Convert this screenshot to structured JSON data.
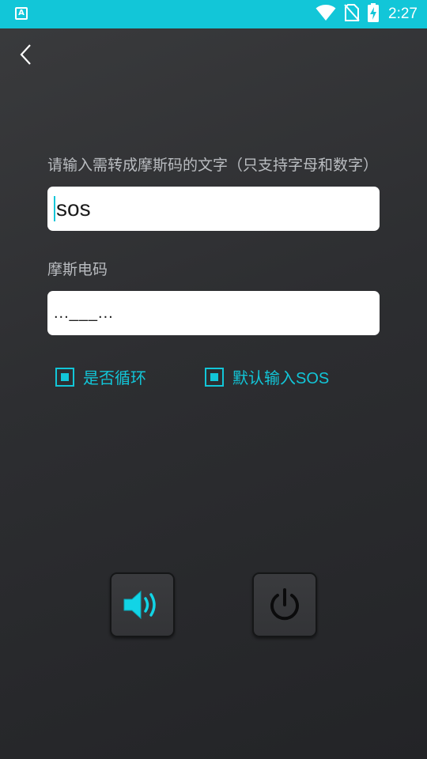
{
  "status_bar": {
    "app_icon_letter": "A",
    "time": "2:27",
    "icons": [
      "wifi-icon",
      "no-sim-icon",
      "battery-charging-icon"
    ]
  },
  "header": {
    "back_icon": "chevron-left-icon"
  },
  "input_section": {
    "label": "请输入需转成摩斯码的文字（只支持字母和数字）",
    "value": "sos"
  },
  "output_section": {
    "label": "摩斯电码",
    "value": "...___..."
  },
  "options": [
    {
      "label": "是否循环",
      "checked": true
    },
    {
      "label": "默认输入SOS",
      "checked": true
    }
  ],
  "controls": {
    "sound_icon": "speaker-icon",
    "power_icon": "power-icon"
  },
  "colors": {
    "accent": "#12c6d8",
    "background": "#2d2e31",
    "label_text": "#b9bcc0"
  }
}
